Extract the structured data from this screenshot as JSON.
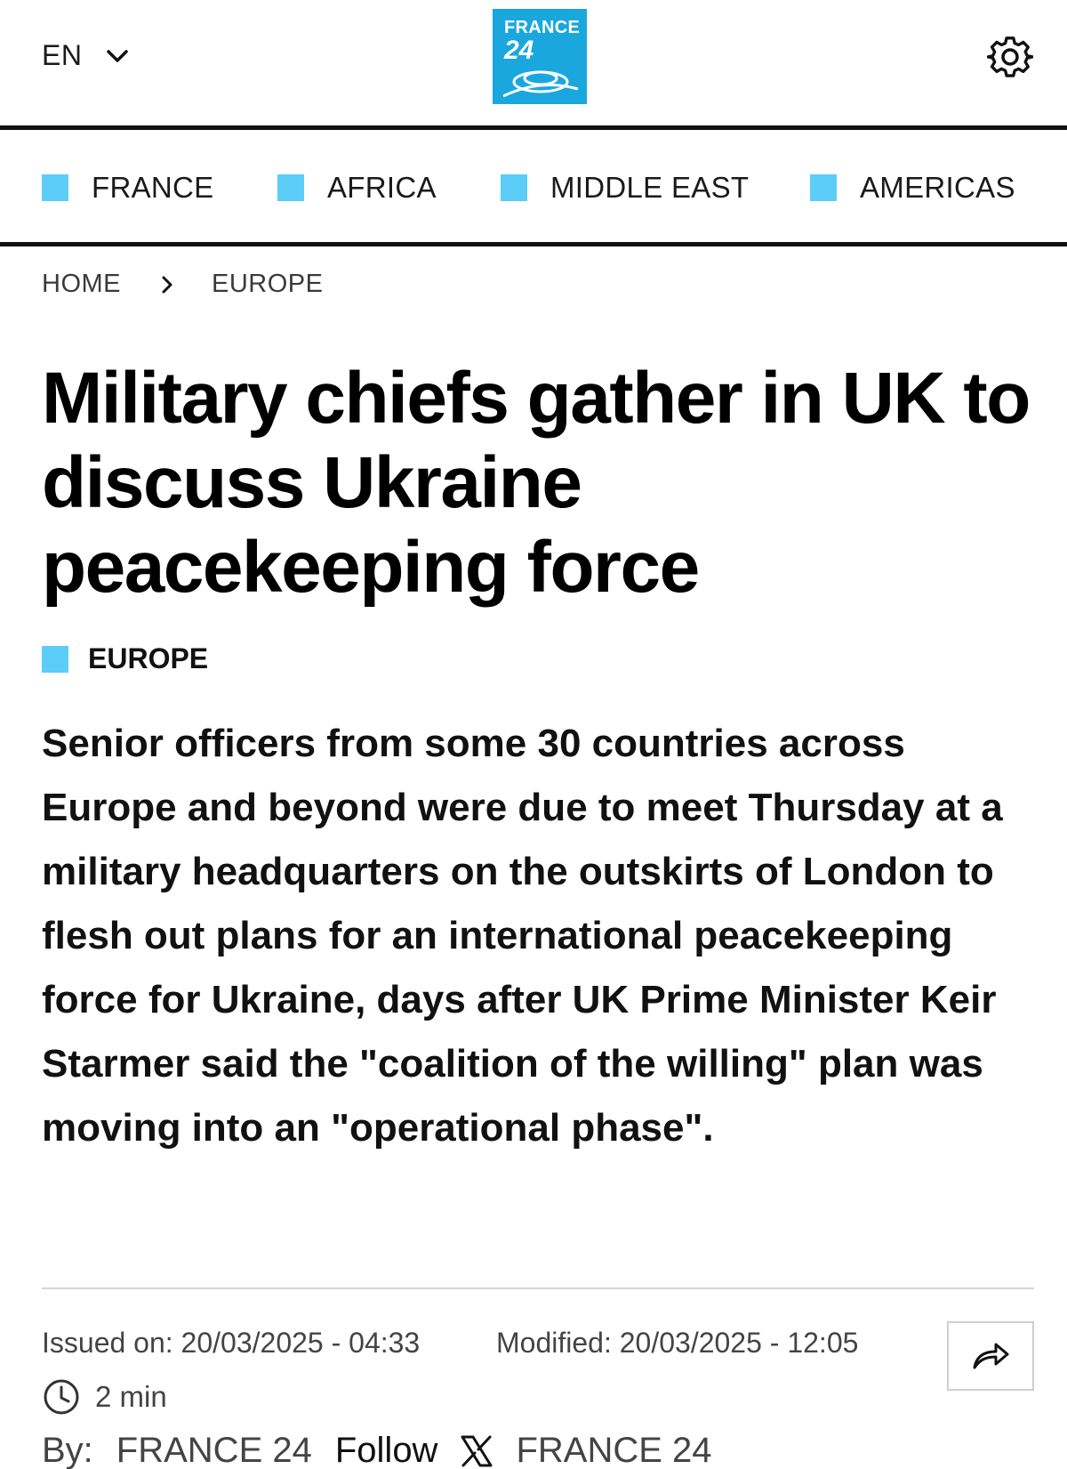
{
  "header": {
    "language": "EN",
    "logo_line1": "FRANCE",
    "logo_line2": "24"
  },
  "nav": {
    "items": [
      {
        "label": "FRANCE"
      },
      {
        "label": "AFRICA"
      },
      {
        "label": "MIDDLE EAST"
      },
      {
        "label": "AMERICAS"
      }
    ],
    "accent_color": "#5bcdf7"
  },
  "breadcrumb": {
    "home": "HOME",
    "section": "EUROPE"
  },
  "article": {
    "title": "Military chiefs gather in UK to discuss Ukraine peacekeeping force",
    "category": "EUROPE",
    "lead": "Senior officers from some 30 countries across Europe and beyond were due to meet Thursday at a military headquarters on the outskirts of London to flesh out plans for an international peacekeeping force for Ukraine, days after UK Prime Minister Keir Starmer said the \"coalition of the willing\" plan was moving into an \"operational phase\"."
  },
  "meta": {
    "issued": "Issued on: 20/03/2025 - 04:33",
    "modified": "Modified: 20/03/2025 - 12:05",
    "read_time": "2 min",
    "by_label": "By:",
    "author": "FRANCE 24",
    "follow_label": "Follow",
    "x_handle": "FRANCE 24"
  },
  "icons": {
    "language_chevron": "chevron-down-icon",
    "settings": "gear-icon",
    "breadcrumb_separator": "chevron-right-icon",
    "share": "share-arrow-icon",
    "read_time": "clock-icon",
    "social": "x-logo-icon"
  }
}
